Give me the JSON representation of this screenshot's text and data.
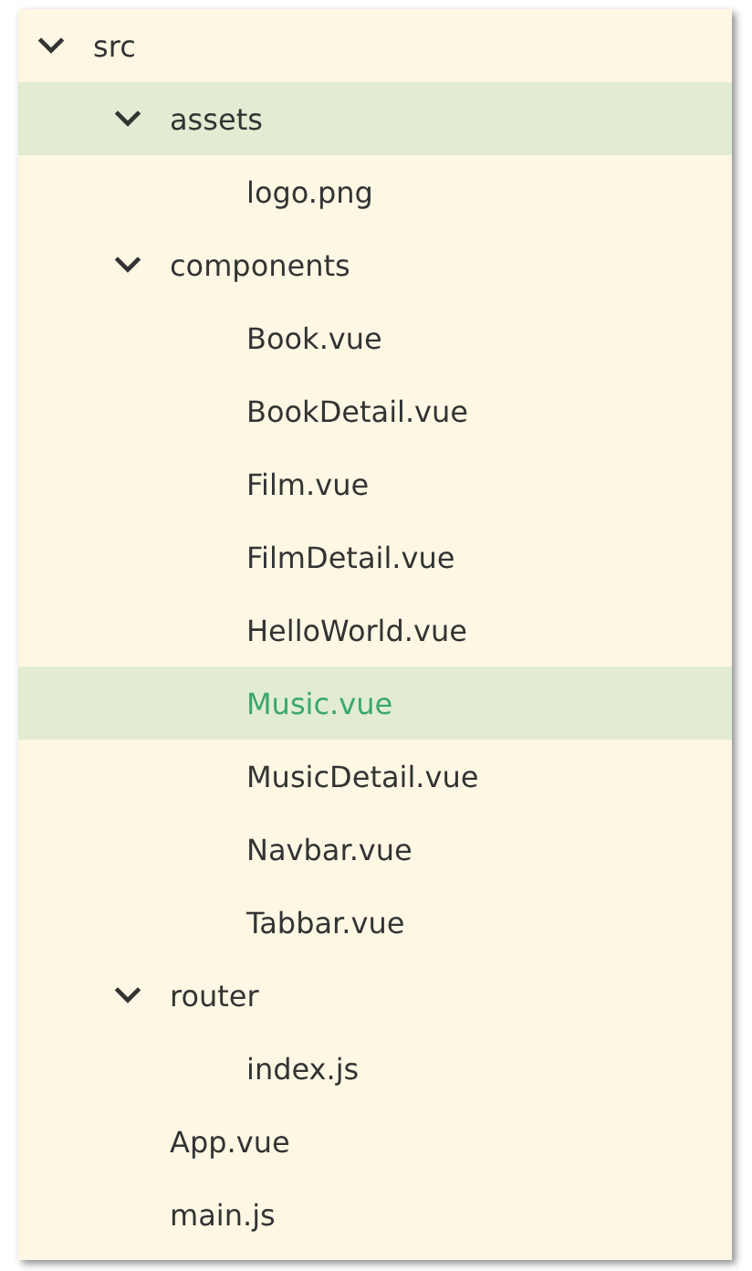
{
  "tree": [
    {
      "kind": "folder",
      "label": "src",
      "expanded": true,
      "selected": false,
      "hovered": false,
      "children": [
        {
          "kind": "folder",
          "label": "assets",
          "expanded": true,
          "selected": false,
          "hovered": true,
          "children": [
            {
              "kind": "file",
              "label": "logo.png",
              "selected": false,
              "hovered": false
            }
          ]
        },
        {
          "kind": "folder",
          "label": "components",
          "expanded": true,
          "selected": false,
          "hovered": false,
          "children": [
            {
              "kind": "file",
              "label": "Book.vue",
              "selected": false,
              "hovered": false
            },
            {
              "kind": "file",
              "label": "BookDetail.vue",
              "selected": false,
              "hovered": false
            },
            {
              "kind": "file",
              "label": "Film.vue",
              "selected": false,
              "hovered": false
            },
            {
              "kind": "file",
              "label": "FilmDetail.vue",
              "selected": false,
              "hovered": false
            },
            {
              "kind": "file",
              "label": "HelloWorld.vue",
              "selected": false,
              "hovered": false
            },
            {
              "kind": "file",
              "label": "Music.vue",
              "selected": true,
              "hovered": false
            },
            {
              "kind": "file",
              "label": "MusicDetail.vue",
              "selected": false,
              "hovered": false
            },
            {
              "kind": "file",
              "label": "Navbar.vue",
              "selected": false,
              "hovered": false
            },
            {
              "kind": "file",
              "label": "Tabbar.vue",
              "selected": false,
              "hovered": false
            }
          ]
        },
        {
          "kind": "folder",
          "label": "router",
          "expanded": true,
          "selected": false,
          "hovered": false,
          "children": [
            {
              "kind": "file",
              "label": "index.js",
              "selected": false,
              "hovered": false
            }
          ]
        },
        {
          "kind": "file",
          "label": "App.vue",
          "selected": false,
          "hovered": false
        },
        {
          "kind": "file",
          "label": "main.js",
          "selected": false,
          "hovered": false
        }
      ]
    }
  ]
}
